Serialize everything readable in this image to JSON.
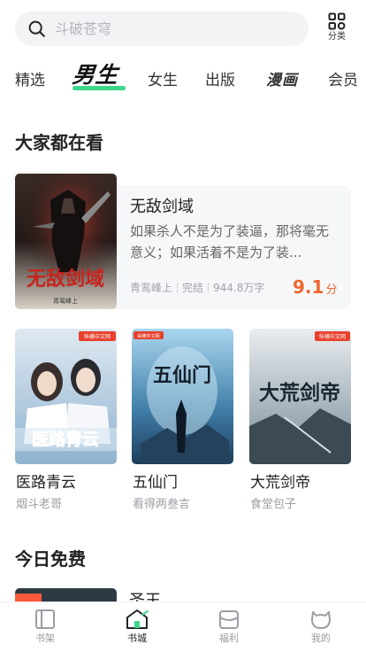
{
  "search": {
    "placeholder": "斗破苍穹"
  },
  "category": {
    "label": "分类"
  },
  "tabs": [
    {
      "label": "精选"
    },
    {
      "label": "男生"
    },
    {
      "label": "女生"
    },
    {
      "label": "出版"
    },
    {
      "label": "漫画"
    },
    {
      "label": "会员"
    }
  ],
  "sections": {
    "popular": "大家都在看",
    "free_today": "今日免费"
  },
  "featured": {
    "title": "无敌剑域",
    "description": "如果杀人不是为了装逼，那将毫无意义；如果活着不是为了装...",
    "author": "青鸾峰上",
    "status": "完结",
    "word_count": "944.8万字",
    "score": "9.1",
    "score_unit": "分",
    "cover_text": "无敌剑域",
    "cover_author": "青鸾峰上"
  },
  "books": [
    {
      "title": "医路青云",
      "author": "烟斗老哥",
      "cover_text": "医路青云",
      "badge": "纵横中文网"
    },
    {
      "title": "五仙门",
      "author": "看得两叁言",
      "cover_text": "五仙门",
      "badge": "纵横中文网"
    },
    {
      "title": "大荒剑帝",
      "author": "食堂包子",
      "cover_text": "大荒剑帝",
      "badge": "纵横中文网"
    }
  ],
  "free_book": {
    "title": "圣王"
  },
  "bottom_nav": [
    {
      "label": "书架",
      "icon": "bookshelf-icon"
    },
    {
      "label": "书城",
      "icon": "bookstore-icon",
      "active": true
    },
    {
      "label": "福利",
      "icon": "gift-icon"
    },
    {
      "label": "我的",
      "icon": "profile-icon"
    }
  ],
  "colors": {
    "accent": "#3ed68a",
    "score": "#f0662f"
  }
}
